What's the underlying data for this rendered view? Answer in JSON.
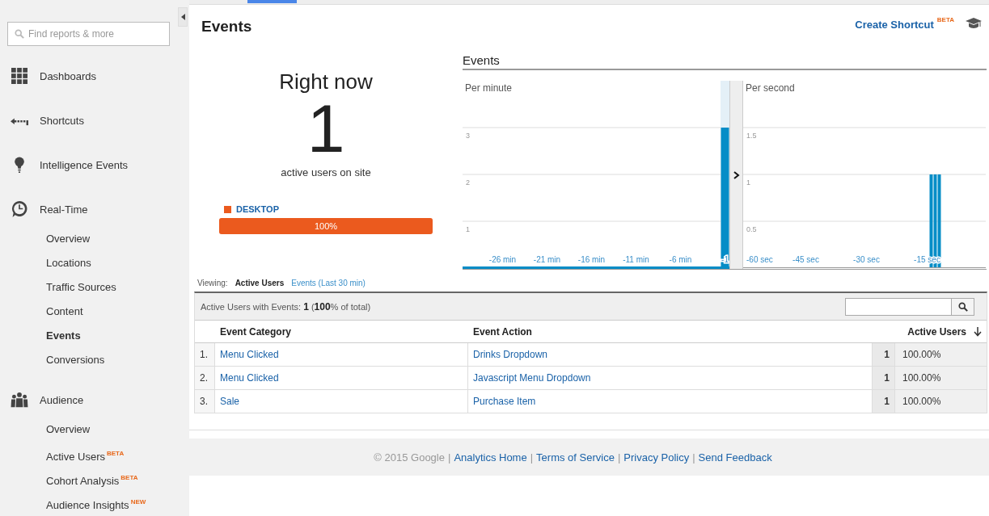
{
  "sidebar": {
    "search": {
      "placeholder": "Find reports & more"
    },
    "sections": [
      {
        "label": "Dashboards",
        "kind": "grid"
      },
      {
        "label": "Shortcuts",
        "kind": "shortcut"
      },
      {
        "label": "Intelligence Events",
        "kind": "bulb"
      },
      {
        "label": "Real-Time",
        "kind": "clock",
        "children": [
          {
            "label": "Overview",
            "selected": false
          },
          {
            "label": "Locations",
            "selected": false
          },
          {
            "label": "Traffic Sources",
            "selected": false
          },
          {
            "label": "Content",
            "selected": false
          },
          {
            "label": "Events",
            "selected": true
          },
          {
            "label": "Conversions",
            "selected": false
          }
        ]
      },
      {
        "label": "Audience",
        "kind": "people",
        "children": [
          {
            "label": "Overview",
            "selected": false
          },
          {
            "label": "Active Users",
            "badge": "BETA",
            "selected": false
          },
          {
            "label": "Cohort Analysis",
            "badge": "BETA",
            "selected": false
          },
          {
            "label": "Audience Insights",
            "badge": "NEW",
            "selected": false
          }
        ]
      }
    ]
  },
  "page": {
    "title": "Events",
    "create_shortcut": "Create Shortcut",
    "create_shortcut_badge": "BETA"
  },
  "right_now": {
    "heading": "Right now",
    "count": "1",
    "caption": "active users on site",
    "devices": [
      {
        "label": "DESKTOP",
        "color": "#eb5a1e",
        "level": 1,
        "reading": "100%"
      }
    ]
  },
  "events_chart": {
    "title": "Events",
    "panels": [
      {
        "label": "Per minute",
        "kind": "minute",
        "chart_data": {
          "type": "bar",
          "grid": true,
          "x": [
            -30,
            -29,
            -28,
            -27,
            -26,
            -25,
            -24,
            -23,
            -22,
            -21,
            -20,
            -19,
            -18,
            -17,
            -16,
            -15,
            -14,
            -13,
            -12,
            -11,
            -10,
            -9,
            -8,
            -7,
            -6,
            -5,
            -4,
            -3,
            -2,
            -1
          ],
          "series": [
            {
              "color": "#058dc7",
              "values": [
                0,
                0,
                0,
                0,
                0,
                0,
                0,
                0,
                0,
                0,
                0,
                0,
                0,
                0,
                0,
                0,
                0,
                0,
                0,
                0,
                0,
                0,
                0,
                0,
                0,
                0,
                0,
                0,
                0,
                3
              ]
            }
          ],
          "xlim": [
            -30.5,
            -0.5
          ],
          "ylim": [
            0,
            4
          ],
          "yticks": [
            1,
            2,
            3
          ],
          "xticks": [
            {
              "value": -26,
              "label": "-26 min"
            },
            {
              "value": -21,
              "label": "-21 min"
            },
            {
              "value": -16,
              "label": "-16 min"
            },
            {
              "value": -11,
              "label": "-11 min"
            },
            {
              "value": -6,
              "label": "-6 min"
            },
            {
              "value": -1,
              "label": "-1"
            }
          ]
        }
      },
      {
        "label": "Per second",
        "kind": "second",
        "chart_data": {
          "type": "bar",
          "grid": true,
          "x": [
            -60,
            -59,
            -58,
            -57,
            -56,
            -55,
            -54,
            -53,
            -52,
            -51,
            -50,
            -49,
            -48,
            -47,
            -46,
            -45,
            -44,
            -43,
            -42,
            -41,
            -40,
            -39,
            -38,
            -37,
            -36,
            -35,
            -34,
            -33,
            -32,
            -31,
            -30,
            -29,
            -28,
            -27,
            -26,
            -25,
            -24,
            -23,
            -22,
            -21,
            -20,
            -19,
            -18,
            -17,
            -16,
            -15,
            -14,
            -13,
            -12,
            -11,
            -10,
            -9,
            -8,
            -7,
            -6,
            -5,
            -4,
            -3,
            -2,
            -1
          ],
          "series": [
            {
              "color": "#058dc7",
              "values": [
                0,
                0,
                0,
                0,
                0,
                0,
                0,
                0,
                0,
                0,
                0,
                0,
                0,
                0,
                0,
                0,
                0,
                0,
                0,
                0,
                0,
                0,
                0,
                0,
                0,
                0,
                0,
                0,
                0,
                0,
                0,
                0,
                0,
                0,
                0,
                0,
                0,
                0,
                0,
                0,
                0,
                0,
                0,
                0,
                0,
                0,
                1,
                1,
                1,
                0,
                0,
                0,
                0,
                0,
                0,
                0,
                0,
                0,
                0,
                0
              ]
            }
          ],
          "xlim": [
            -60.5,
            -0.5
          ],
          "ylim": [
            0,
            2
          ],
          "yticks": [
            0.5,
            1,
            1.5
          ],
          "xticks": [
            {
              "value": -60,
              "label": "-60 sec"
            },
            {
              "value": -45,
              "label": "-45 sec"
            },
            {
              "value": -30,
              "label": "-30 sec"
            },
            {
              "value": -15,
              "label": "-15 sec"
            }
          ]
        }
      }
    ]
  },
  "viewing": {
    "label": "Viewing:",
    "tabs": [
      {
        "label": "Active Users",
        "selected": true
      },
      {
        "label": "Events (Last 30 min)",
        "selected": false
      }
    ]
  },
  "table": {
    "summary": "Active Users with Events: **1** (**100**% of total)",
    "columns": [
      "Event Category",
      "Event Action",
      "Active Users"
    ],
    "rows": [
      {
        "index": "1.",
        "category": "Menu Clicked",
        "action": "Drinks Dropdown",
        "users": "1",
        "share": "100.00%"
      },
      {
        "index": "2.",
        "category": "Menu Clicked",
        "action": "Javascript Menu Dropdown",
        "users": "1",
        "share": "100.00%"
      },
      {
        "index": "3.",
        "category": "Sale",
        "action": "Purchase Item",
        "users": "1",
        "share": "100.00%"
      }
    ]
  },
  "footer": [
    {
      "text": "© 2015 Google",
      "kind": "text"
    },
    {
      "text": "|",
      "kind": "separator"
    },
    {
      "text": "Analytics Home",
      "kind": "link"
    },
    {
      "text": "|",
      "kind": "separator"
    },
    {
      "text": "Terms of Service",
      "kind": "link"
    },
    {
      "text": "|",
      "kind": "separator"
    },
    {
      "text": "Privacy Policy",
      "kind": "link"
    },
    {
      "text": "|",
      "kind": "separator"
    },
    {
      "text": "Send Feedback",
      "kind": "link"
    }
  ]
}
